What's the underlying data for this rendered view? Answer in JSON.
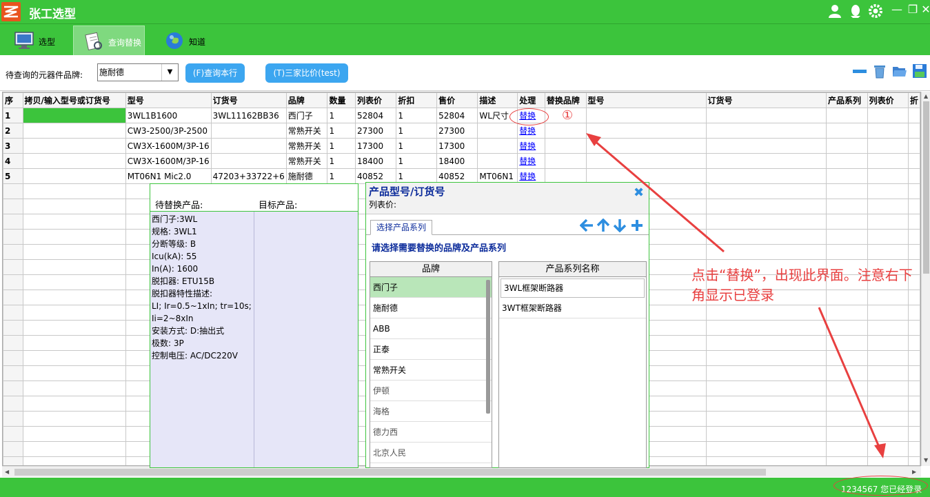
{
  "app": {
    "title": "张工选型"
  },
  "window_controls": {
    "minimize": "—",
    "restore": "❐",
    "close": "✕"
  },
  "tabs": [
    {
      "label": "选型"
    },
    {
      "label": "查询替换"
    },
    {
      "label": "知道"
    }
  ],
  "toolbar": {
    "brand_label": "待查询的元器件品牌:",
    "brand_value": "施耐德",
    "query_button": "(F)查询本行",
    "compare_button": "(T)三家比价(test)"
  },
  "grid": {
    "columns": [
      "序",
      "拷贝/输入型号或订货号",
      "型号",
      "订货号",
      "品牌",
      "数量",
      "列表价",
      "折扣",
      "售价",
      "描述",
      "处理",
      "替换品牌",
      "型号",
      "订货号",
      "产品系列",
      "列表价",
      "折"
    ],
    "rows": [
      {
        "idx": "1",
        "model": "3WL1B1600",
        "order": "3WL11162BB36",
        "brand": "西门子",
        "qty": "1",
        "list": "52804",
        "disc": "1",
        "price": "52804",
        "desc": "WL尺寸",
        "action": "替换"
      },
      {
        "idx": "2",
        "model": "CW3-2500/3P-2500",
        "order": "",
        "brand": "常熟开关",
        "qty": "1",
        "list": "27300",
        "disc": "1",
        "price": "27300",
        "desc": "",
        "action": "替换"
      },
      {
        "idx": "3",
        "model": "CW3X-1600M/3P-16",
        "order": "",
        "brand": "常熟开关",
        "qty": "1",
        "list": "17300",
        "disc": "1",
        "price": "17300",
        "desc": "",
        "action": "替换"
      },
      {
        "idx": "4",
        "model": "CW3X-1600M/3P-16",
        "order": "",
        "brand": "常熟开关",
        "qty": "1",
        "list": "18400",
        "disc": "1",
        "price": "18400",
        "desc": "",
        "action": "替换"
      },
      {
        "idx": "5",
        "model": "MT06N1 Mic2.0",
        "order": "47203+33722+6",
        "brand": "施耐德",
        "qty": "1",
        "list": "40852",
        "disc": "1",
        "price": "40852",
        "desc": "MT06N1",
        "action": "替换"
      }
    ]
  },
  "replace_panel": {
    "source_label": "待替换产品:",
    "target_label": "目标产品:",
    "specs": [
      "西门子:3WL",
      "规格: 3WL1",
      "分断等级: B",
      "Icu(kA): 55",
      "In(A): 1600",
      "脱扣器: ETU15B",
      "脱扣器特性描述:",
      "LI; Ir=0.5~1xIn; tr=10s;",
      "Ii=2~8xIn",
      "安装方式: D:抽出式",
      "极数: 3P",
      "控制电压: AC/DC220V"
    ]
  },
  "product_dialog": {
    "title": "产品型号/订货号",
    "subtitle": "列表价:",
    "close": "✖",
    "tab": "选择产品系列",
    "instruction": "请选择需要替换的品牌及产品系列",
    "brand_header": "品牌",
    "brands": [
      "西门子",
      "施耐德",
      "ABB",
      "正泰",
      "常熟开关",
      "伊顿",
      "海格",
      "德力西",
      "北京人民"
    ],
    "series_header": "产品系列名称",
    "series": [
      "3WL框架断路器",
      "3WT框架断路器"
    ]
  },
  "annotation": {
    "number": "①",
    "note": "点击“替换”，出现此界面。注意右下角显示已登录"
  },
  "status": {
    "text": "1234567 您已经登录"
  },
  "colors": {
    "accent": "#3cc43c",
    "annotation": "#e84040",
    "button": "#3ca6f0"
  }
}
